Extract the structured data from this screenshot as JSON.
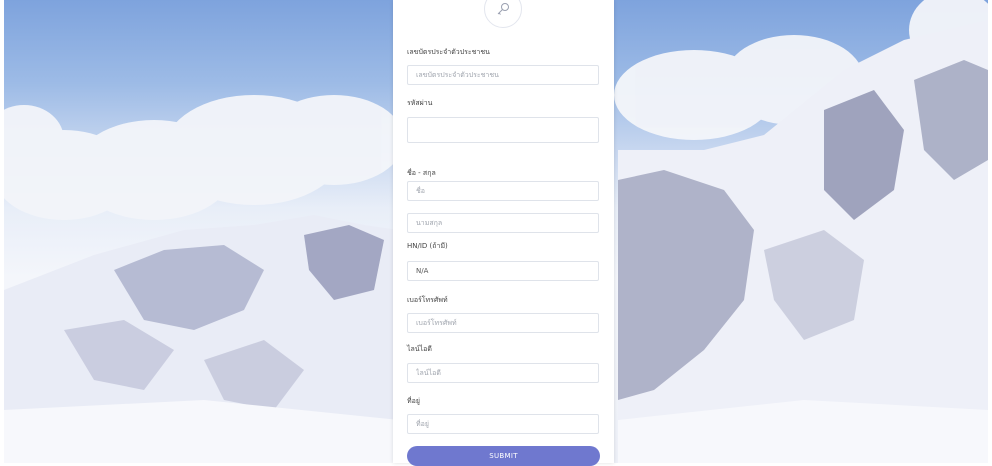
{
  "form": {
    "fields": [
      {
        "label": "เลขบัตรประจำตัวประชาชน",
        "placeholder": "เลขบัตรประจำตัวประชาชน",
        "value": ""
      },
      {
        "label": "รหัสผ่าน",
        "placeholder": "",
        "value": ""
      },
      {
        "label": "ชื่อ - สกุล",
        "placeholder": "ชื่อ",
        "value": ""
      },
      {
        "label": "",
        "placeholder": "นามสกุล",
        "value": ""
      },
      {
        "label": "HN/ID (ถ้ามี)",
        "placeholder": "",
        "value": "N/A"
      },
      {
        "label": "เบอร์โทรศัพท์",
        "placeholder": "เบอร์โทรศัพท์",
        "value": ""
      },
      {
        "label": "ไลน์ไอดี",
        "placeholder": "ไลน์ไอดี",
        "value": ""
      },
      {
        "label": "ที่อยู่",
        "placeholder": "ที่อยู่",
        "value": ""
      }
    ],
    "submit_label": "SUBMIT",
    "header_icon": "key-icon"
  },
  "colors": {
    "accent": "#6f78cf",
    "sky": "#7ea3dd",
    "snow": "#f4f6fb"
  }
}
